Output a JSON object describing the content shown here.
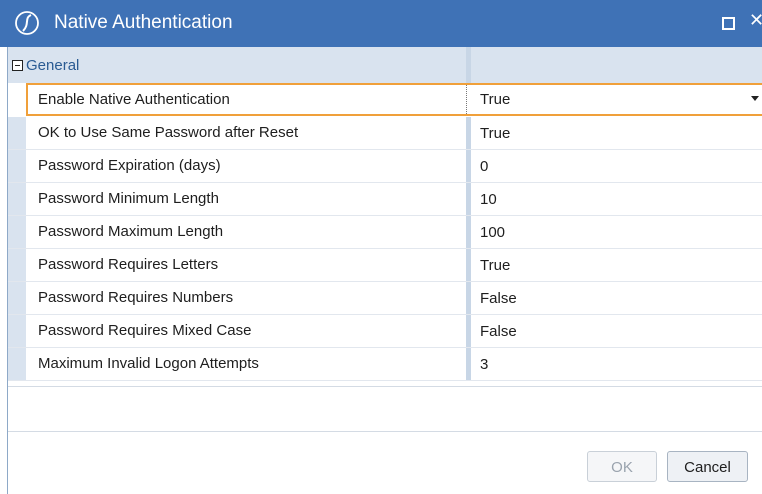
{
  "window": {
    "title": "Native Authentication",
    "maximize_icon": "maximize-icon",
    "close_symbol": "✕",
    "title_bar_color": "#3f72b6"
  },
  "property_grid": {
    "category": {
      "expander_icon": "collapse-minus-icon",
      "label": "General"
    },
    "rows": [
      {
        "name": "Enable Native Authentication",
        "value": "True",
        "selected": true
      },
      {
        "name": "OK to Use Same Password after Reset",
        "value": "True"
      },
      {
        "name": "Password Expiration (days)",
        "value": "0"
      },
      {
        "name": "Password Minimum Length",
        "value": "10"
      },
      {
        "name": "Password Maximum Length",
        "value": "100"
      },
      {
        "name": "Password Requires Letters",
        "value": "True"
      },
      {
        "name": "Password Requires Numbers",
        "value": "False"
      },
      {
        "name": "Password Requires Mixed Case",
        "value": "False"
      },
      {
        "name": "Maximum Invalid Logon Attempts",
        "value": "3"
      }
    ],
    "selection_color": "#f0a03a"
  },
  "buttons": {
    "ok_label": "OK",
    "cancel_label": "Cancel"
  }
}
